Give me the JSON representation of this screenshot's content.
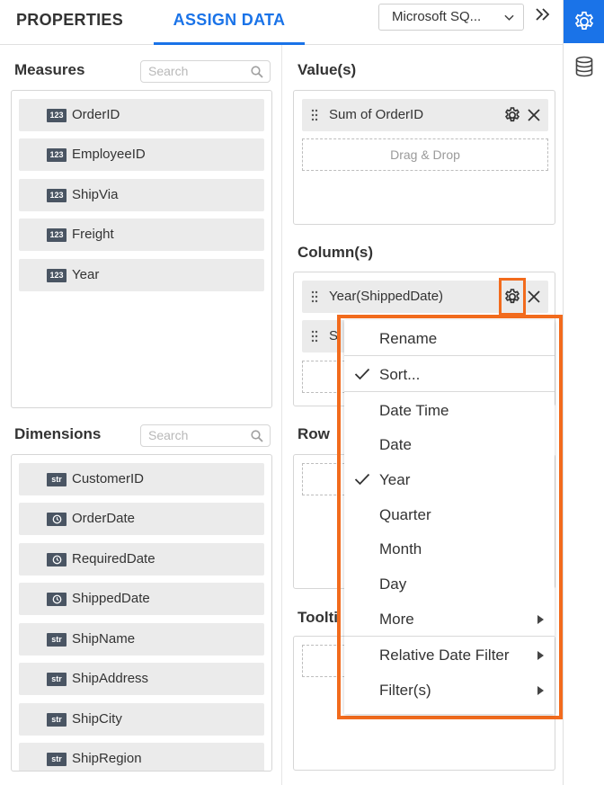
{
  "tabs": {
    "properties": "PROPERTIES",
    "assign_data": "ASSIGN DATA"
  },
  "datasource": {
    "value": "Microsoft SQ..."
  },
  "icons": {
    "collapse": "double-chevron-right-icon",
    "settings": "gear-icon",
    "data": "database-icon"
  },
  "colors": {
    "accent": "#1a73e8",
    "highlight": "#f26b1d"
  },
  "measures": {
    "title": "Measures",
    "search_placeholder": "Search",
    "items": [
      {
        "badge": "123",
        "label": "OrderID"
      },
      {
        "badge": "123",
        "label": "EmployeeID"
      },
      {
        "badge": "123",
        "label": "ShipVia"
      },
      {
        "badge": "123",
        "label": "Freight"
      },
      {
        "badge": "123",
        "label": "Year"
      }
    ]
  },
  "dimensions": {
    "title": "Dimensions",
    "search_placeholder": "Search",
    "items": [
      {
        "badge": "str",
        "label": "CustomerID"
      },
      {
        "badge": "clock",
        "label": "OrderDate"
      },
      {
        "badge": "clock",
        "label": "RequiredDate"
      },
      {
        "badge": "clock",
        "label": "ShippedDate"
      },
      {
        "badge": "str",
        "label": "ShipName"
      },
      {
        "badge": "str",
        "label": "ShipAddress"
      },
      {
        "badge": "str",
        "label": "ShipCity"
      },
      {
        "badge": "str",
        "label": "ShipRegion"
      }
    ]
  },
  "values": {
    "title": "Value(s)",
    "item": "Sum of OrderID",
    "drop_text": "Drag & Drop"
  },
  "columns": {
    "title": "Column(s)",
    "item": "Year(ShippedDate)",
    "item2_partial": "S"
  },
  "row": {
    "title": "Row"
  },
  "tooltip": {
    "title": "Toolti"
  },
  "context_menu": {
    "items": [
      {
        "label": "Rename",
        "checked": false,
        "submenu": false
      },
      {
        "label": "Sort...",
        "checked": true,
        "submenu": false
      },
      {
        "label": "Date Time",
        "checked": false,
        "submenu": false
      },
      {
        "label": "Date",
        "checked": false,
        "submenu": false
      },
      {
        "label": "Year",
        "checked": true,
        "submenu": false
      },
      {
        "label": "Quarter",
        "checked": false,
        "submenu": false
      },
      {
        "label": "Month",
        "checked": false,
        "submenu": false
      },
      {
        "label": "Day",
        "checked": false,
        "submenu": false
      },
      {
        "label": "More",
        "checked": false,
        "submenu": true
      },
      {
        "label": "Relative Date Filter",
        "checked": false,
        "submenu": true
      },
      {
        "label": "Filter(s)",
        "checked": false,
        "submenu": true
      }
    ]
  }
}
